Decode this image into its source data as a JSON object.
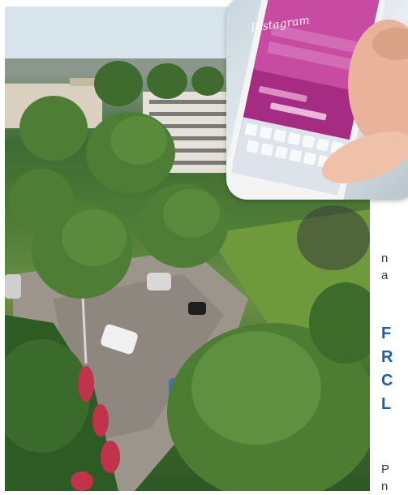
{
  "photo": {
    "alt_icon": "aerial-street-photo"
  },
  "inset": {
    "logo_text": "Instagram",
    "app_icon": "smartphone-icon"
  },
  "side_text": {
    "line_1": "n",
    "line_2": "a",
    "heading_lines": [
      "F",
      "R",
      "C",
      "L"
    ],
    "line_3": "P",
    "line_4": "n"
  },
  "colors": {
    "heading": "#1d5ea8",
    "body": "#3b3b3b",
    "instagram_pink": "#c8288f"
  }
}
